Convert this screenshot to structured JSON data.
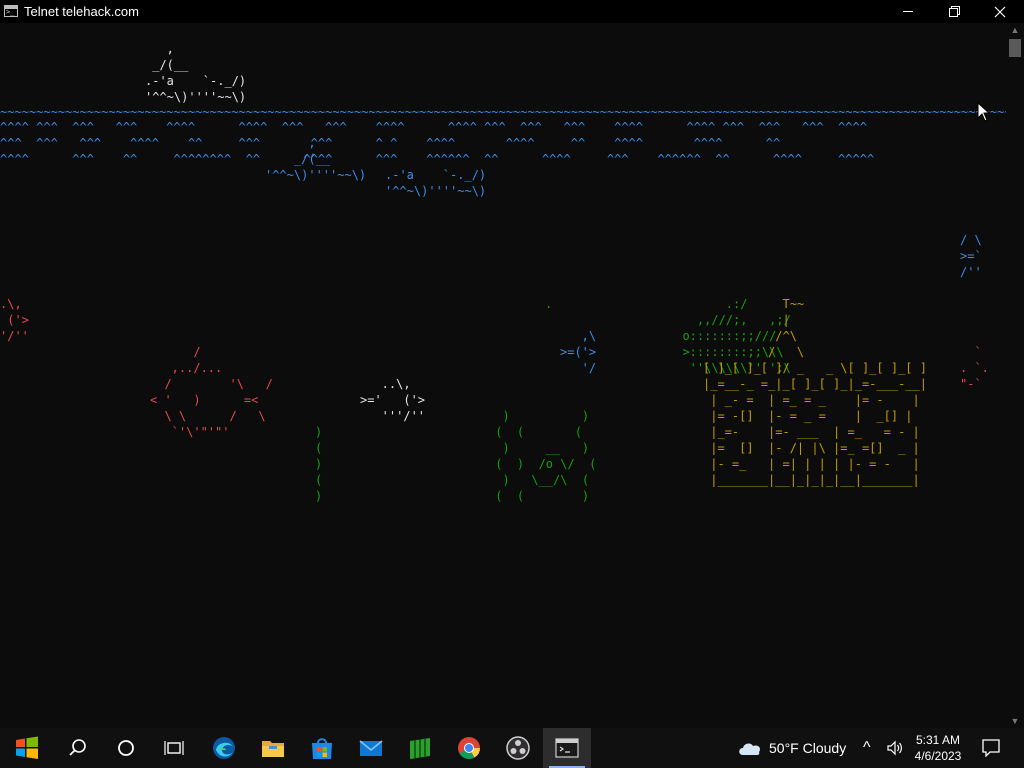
{
  "window": {
    "title": "Telnet telehack.com"
  },
  "terminal": {
    "boat": "   ,\n _/(__\n.-'a    `-._/)\n'^^~\\)''''~~\\)",
    "waves_line": "~~~~~~~~~~~~~~~~~~~~~~~~~~~~~~~~~~~~~~~~~~~~~~~~~~~~~~~~~~~~~~~~~~~~~~~~~~~~~~~~~~~~~~~~~~~~~~~~~~~~~~~~~~~~~~~~~~~~~~~~~~~~~~~~~~~~~~~~~~~~~~~~~~~~~~~~~~~~~~~",
    "waves_row1": "^^^^ ^^^  ^^^   ^^^    ^^^^      ^^^^  ^^^   ^^^    ^^^^      ^^^^ ^^^  ^^^   ^^^    ^^^^      ^^^^ ^^^  ^^^   ^^^  ^^^^",
    "waves_row2": "^^^  ^^^   ^^^    ^^^^    ^^     ^^^       ^^^      ^ ^    ^^^^       ^^^^     ^^    ^^^^       ^^^^      ^^",
    "waves_row3": "^^^^      ^^^    ^^     ^^^^^^^^  ^^      ^^^^      ^^^    ^^^^^^  ^^      ^^^^     ^^^    ^^^^^^  ^^      ^^^^     ^^^^^",
    "submerged_boat_a": "      ,\n    _/(__\n'^^~\\)''''~~\\)",
    "submerged_boat_b": ".-'a    `-._/)\n'^^~\\)''''~~\\)",
    "fish_right_edge": "/ \\\n>=`\n/''",
    "fish_left": ".\\,\n ('>\n'/''",
    "dot": ".",
    "fish_red": "   ,\\\n>=('>\n   '/",
    "big_fish": "      /\n   ,../...\n  /        '\\   /\n< '   )      =<\n  \\ \\      /   \\\n   `'\\'\"'\"'",
    "fish_white": "   ..\\,\n>='   ('>\n   '''/''",
    "seaweed_a": ")\n(\n)\n(\n)",
    "seaweed_b": "  )          )\n (  (       (\n  )     __   )\n (  )  /o \\/  (\n  )   \\__/\\  (\n (  (        )",
    "bubble": "o",
    "stars": "        .:/\n    ,,///;,   ,;/\n  o:::::::;;///\n  >::::::::;;\\\\\\\n   ''\\\\\\\\\\\\'' ';\\",
    "castle": "           T~~\n           |\n          /^\\\n         /   \\\n[ ]_[ ]_[ ]/ _   _ \\[ ]_[ ]_[ ]\n|_=__-_ =_|_[ ]_[ ]_|_=-___-__|\n | _- =  | =_ = _    |= -    |\n |= -[]  |- = _ =    |  _[] |\n |_=-    |=- ___  | =_   = - |\n |=  []  |- /| |\\ |=_ =[]  _ |\n |- =_   | =| | | | |- = -   |\n |_______|__|_|_|_|__|_______|",
    "snail": "  `\n. `.\n\"-`"
  },
  "scrollbar": {
    "up_arrow": "▲",
    "down_arrow": "▼"
  },
  "taskbar": {
    "weather": "50°F  Cloudy",
    "time": "5:31 AM",
    "date": "4/6/2023",
    "chevron": "^"
  },
  "icons": [
    "windows-logo-icon",
    "search-icon",
    "cortana-icon",
    "task-view-icon",
    "edge-icon",
    "file-explorer-icon",
    "store-icon",
    "mail-icon",
    "green-app-icon",
    "chrome-icon",
    "obs-icon",
    "terminal-icon",
    "cloud-icon",
    "volume-icon",
    "notification-icon"
  ],
  "colors": {
    "terminal_bg": "#0c0c0c",
    "water": "#3b8eea",
    "boat": "#e5e5e5",
    "boat_trail": "#61d6d6",
    "seaweed": "#13a10e",
    "castle": "#c19c00",
    "fish_red": "#e74856",
    "taskbar_bg": "#101010"
  }
}
